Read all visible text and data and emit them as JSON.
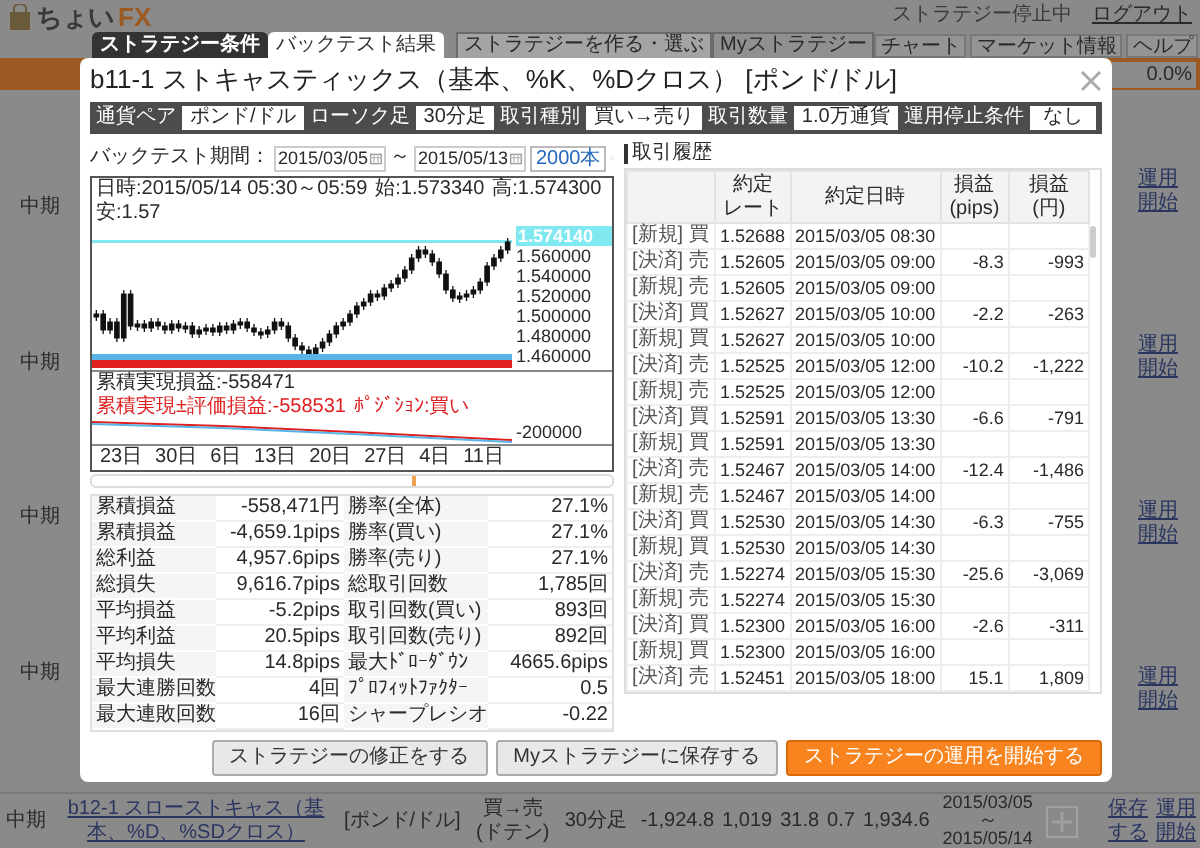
{
  "header": {
    "logo": "ちょい",
    "logo_accent": "FX",
    "status": "ストラテジー停止中",
    "logout": "ログアウト"
  },
  "nav": [
    {
      "label": "ストラテジーを作る・選ぶ",
      "selected": true
    },
    {
      "label": "Myストラテジー",
      "selected": false
    }
  ],
  "menu": [
    "チャート",
    "マーケット情報",
    "ヘルプ"
  ],
  "balance_rate": "0.0%",
  "list": {
    "terms": [
      "中期",
      "中期",
      "中期",
      "中期"
    ],
    "actions": [
      "運用開始",
      "運用開始",
      "運用開始",
      "運用開始"
    ]
  },
  "bottom_row": {
    "term": "中期",
    "name": "b12-1 スローストキャス（基本、%D、%SDクロス）",
    "pair": "[ポンド/ドル]",
    "trade": "買→売",
    "trade_note": "(ドテン)",
    "candle": "30分足",
    "values": [
      "-1,924.8",
      "1,019",
      "31.8",
      "0.7",
      "1,934.6"
    ],
    "from": "2015/03/05",
    "sep": "～",
    "to": "2015/05/14",
    "save": "保存する",
    "start": "運用開始"
  },
  "modal": {
    "tabs": [
      {
        "label": "ストラテジー条件",
        "selected": false
      },
      {
        "label": "バックテスト結果",
        "selected": true
      }
    ],
    "title": "b11-1 ストキャスティックス（基本、%K、%Dクロス） [ポンド/ドル]",
    "conditions": [
      {
        "label": "通貨ペア",
        "value": "ポンド/ドル"
      },
      {
        "label": "ローソク足",
        "value": "30分足"
      },
      {
        "label": "取引種別",
        "value": "買い→売り"
      },
      {
        "label": "取引数量",
        "value": "1.0万通貨"
      },
      {
        "label": "運用停止条件",
        "value": "なし"
      }
    ],
    "period": {
      "label": "バックテスト期間：",
      "from": "2015/03/05",
      "sep": "～",
      "to": "2015/05/13",
      "bars": "2000本"
    },
    "chart": {
      "info": [
        "日時:2015/05/14 05:30～05:59",
        "始:1.573340",
        "高:1.574300",
        "安:1.57"
      ],
      "price_tag": "1.574140",
      "y_labels": [
        "1.560000",
        "1.540000",
        "1.520000",
        "1.500000",
        "1.480000",
        "1.460000"
      ],
      "pl_label": "累積実現損益:-558471",
      "total_label": "累積実現±評価損益:-558531",
      "position_label": "ﾎﾟｼﾞｼｮﾝ:買い",
      "sub_label": "-200000",
      "x_labels": [
        "23日",
        "30日",
        "6日",
        "13日",
        "20日",
        "27日",
        "4日",
        "11日"
      ]
    },
    "stats": [
      {
        "label": "累積損益",
        "value": "-558,471円"
      },
      {
        "label": "勝率(全体)",
        "value": "27.1%"
      },
      {
        "label": "累積損益",
        "value": "-4,659.1pips"
      },
      {
        "label": "勝率(買い)",
        "value": "27.1%"
      },
      {
        "label": "総利益",
        "value": "4,957.6pips"
      },
      {
        "label": "勝率(売り)",
        "value": "27.1%"
      },
      {
        "label": "総損失",
        "value": "9,616.7pips"
      },
      {
        "label": "総取引回数",
        "value": "1,785回"
      },
      {
        "label": "平均損益",
        "value": "-5.2pips"
      },
      {
        "label": "取引回数(買い)",
        "value": "893回"
      },
      {
        "label": "平均利益",
        "value": "20.5pips"
      },
      {
        "label": "取引回数(売り)",
        "value": "892回"
      },
      {
        "label": "平均損失",
        "value": "14.8pips"
      },
      {
        "label": "最大ﾄﾞﾛｰﾀﾞｳﾝ",
        "value": "4665.6pips"
      },
      {
        "label": "最大連勝回数",
        "value": "4回"
      },
      {
        "label": "ﾌﾟﾛﾌｨｯﾄﾌｧｸﾀｰ",
        "value": "0.5"
      },
      {
        "label": "最大連敗回数",
        "value": "16回"
      },
      {
        "label": "シャープレシオ",
        "value": "-0.22"
      }
    ],
    "history": {
      "title": "取引履歴",
      "columns": [
        [
          "約定",
          "レート"
        ],
        [
          "約定日時"
        ],
        [
          "損益",
          "(pips)"
        ],
        [
          "損益",
          "(円)"
        ]
      ],
      "rows": [
        {
          "type": "[新規] 買",
          "rate": "1.52688",
          "date": "2015/03/05 08:30"
        },
        {
          "type": "[決済] 売",
          "rate": "1.52605",
          "date": "2015/03/05 09:00",
          "pips": "-8.3",
          "yen": "-993"
        },
        {
          "type": "[新規] 売",
          "rate": "1.52605",
          "date": "2015/03/05 09:00"
        },
        {
          "type": "[決済] 買",
          "rate": "1.52627",
          "date": "2015/03/05 10:00",
          "pips": "-2.2",
          "yen": "-263"
        },
        {
          "type": "[新規] 買",
          "rate": "1.52627",
          "date": "2015/03/05 10:00"
        },
        {
          "type": "[決済] 売",
          "rate": "1.52525",
          "date": "2015/03/05 12:00",
          "pips": "-10.2",
          "yen": "-1,222"
        },
        {
          "type": "[新規] 売",
          "rate": "1.52525",
          "date": "2015/03/05 12:00"
        },
        {
          "type": "[決済] 買",
          "rate": "1.52591",
          "date": "2015/03/05 13:30",
          "pips": "-6.6",
          "yen": "-791"
        },
        {
          "type": "[新規] 買",
          "rate": "1.52591",
          "date": "2015/03/05 13:30"
        },
        {
          "type": "[決済] 売",
          "rate": "1.52467",
          "date": "2015/03/05 14:00",
          "pips": "-12.4",
          "yen": "-1,486"
        },
        {
          "type": "[新規] 売",
          "rate": "1.52467",
          "date": "2015/03/05 14:00"
        },
        {
          "type": "[決済] 買",
          "rate": "1.52530",
          "date": "2015/03/05 14:30",
          "pips": "-6.3",
          "yen": "-755"
        },
        {
          "type": "[新規] 買",
          "rate": "1.52530",
          "date": "2015/03/05 14:30"
        },
        {
          "type": "[決済] 売",
          "rate": "1.52274",
          "date": "2015/03/05 15:30",
          "pips": "-25.6",
          "yen": "-3,069"
        },
        {
          "type": "[新規] 売",
          "rate": "1.52274",
          "date": "2015/03/05 15:30"
        },
        {
          "type": "[決済] 買",
          "rate": "1.52300",
          "date": "2015/03/05 16:00",
          "pips": "-2.6",
          "yen": "-311"
        },
        {
          "type": "[新規] 買",
          "rate": "1.52300",
          "date": "2015/03/05 16:00"
        },
        {
          "type": "[決済] 売",
          "rate": "1.52451",
          "date": "2015/03/05 18:00",
          "pips": "15.1",
          "yen": "1,809"
        }
      ]
    },
    "buttons": [
      {
        "label": "ストラテジーの修正をする",
        "kind": "default"
      },
      {
        "label": "Myストラテジーに保存する",
        "kind": "default"
      },
      {
        "label": "ストラテジーの運用を開始する",
        "kind": "primary"
      }
    ]
  }
}
